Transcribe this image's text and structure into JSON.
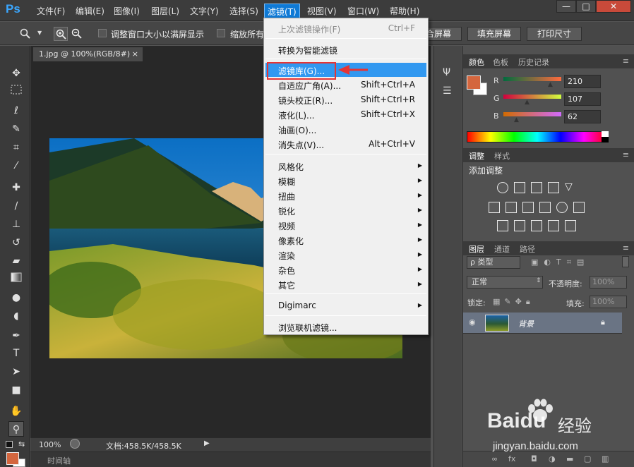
{
  "app": {
    "logo": "Ps"
  },
  "menubar": {
    "items": [
      "文件(F)",
      "编辑(E)",
      "图像(I)",
      "图层(L)",
      "文字(Y)",
      "选择(S)",
      "滤镜(T)",
      "视图(V)",
      "窗口(W)",
      "帮助(H)"
    ],
    "window_controls": [
      "—",
      "□",
      "✕"
    ]
  },
  "options_bar": {
    "resize_window_label": "调整窗口大小以满屏显示",
    "zoom_all_label": "缩放所有",
    "fill_screen_suffix": "合屏幕",
    "fill_screen_button": "填充屏幕",
    "print_size_button": "打印尺寸"
  },
  "document": {
    "tab_title": "1.jpg @ 100%(RGB/8#)",
    "tab_close": "×",
    "zoom": "100%",
    "doc_info": "文档:458.5K/458.5K",
    "timeline_label": "时间轴"
  },
  "filter_menu": {
    "last_filter": {
      "label": "上次滤镜操作(F)",
      "shortcut": "Ctrl+F"
    },
    "convert_smart": "转换为智能滤镜",
    "gallery": "滤镜库(G)...",
    "items_group1": [
      {
        "label": "自适应广角(A)...",
        "shortcut": "Shift+Ctrl+A"
      },
      {
        "label": "镜头校正(R)...",
        "shortcut": "Shift+Ctrl+R"
      },
      {
        "label": "液化(L)...",
        "shortcut": "Shift+Ctrl+X"
      },
      {
        "label": "油画(O)...",
        "shortcut": ""
      },
      {
        "label": "消失点(V)...",
        "shortcut": "Alt+Ctrl+V"
      }
    ],
    "submenus": [
      "风格化",
      "模糊",
      "扭曲",
      "锐化",
      "视频",
      "像素化",
      "渲染",
      "杂色",
      "其它"
    ],
    "digimarc": "Digimarc",
    "browse_online": "浏览联机滤镜..."
  },
  "color_panel": {
    "tabs": [
      "颜色",
      "色板",
      "历史记录"
    ],
    "foreground": "#d4663e",
    "r_label": "R",
    "g_label": "G",
    "b_label": "B",
    "r_value": "210",
    "g_value": "107",
    "b_value": "62"
  },
  "adjust_panel": {
    "tabs": [
      "调整",
      "样式"
    ],
    "title": "添加调整"
  },
  "layers_panel": {
    "tabs": [
      "图层",
      "通道",
      "路径"
    ],
    "kind_filter": "ρ 类型",
    "blend_mode": "正常",
    "opacity_label": "不透明度:",
    "opacity_value": "100%",
    "lock_label": "锁定:",
    "fill_label": "填充:",
    "fill_value": "100%",
    "layer_name": "背景"
  },
  "watermark": {
    "brand": "Baidu",
    "brand_suffix": "经验",
    "url": "jingyan.baidu.com"
  }
}
